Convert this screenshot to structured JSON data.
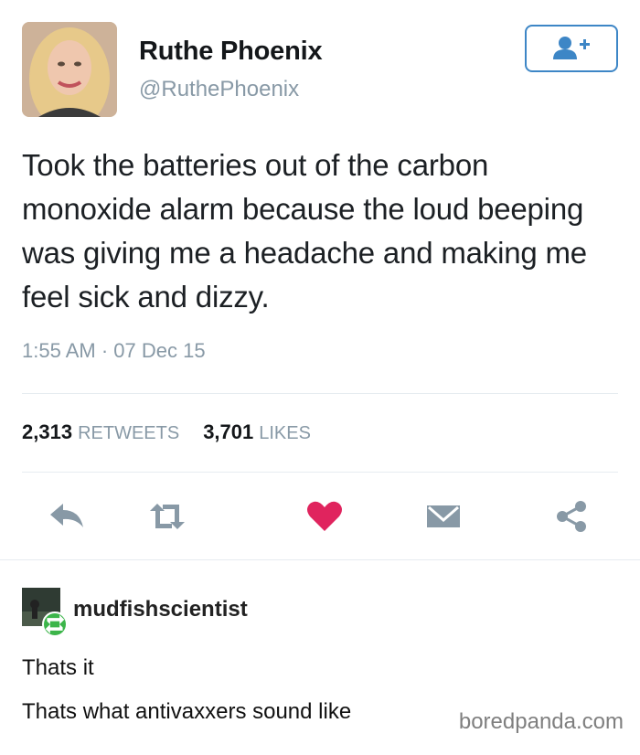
{
  "tweet": {
    "display_name": "Ruthe Phoenix",
    "handle": "@RuthePhoenix",
    "text": "Took the batteries out of the carbon monoxide alarm because the loud beeping was giving me a headache and making me feel sick and dizzy.",
    "timestamp": "1:55 AM · 07 Dec 15",
    "retweets_count": "2,313",
    "retweets_label": "RETWEETS",
    "likes_count": "3,701",
    "likes_label": "LIKES",
    "follow_icon": "add-user-icon",
    "colors": {
      "accent": "#3d86c6",
      "like": "#e0245e",
      "muted": "#8899a6"
    },
    "actions": [
      {
        "icon": "reply-icon"
      },
      {
        "icon": "retweet-icon"
      },
      {
        "icon": "heart-icon"
      },
      {
        "icon": "message-icon"
      },
      {
        "icon": "share-icon"
      }
    ]
  },
  "reblog": {
    "username": "mudfishscientist",
    "badge_icon": "reblog-icon",
    "lines": [
      "Thats it",
      "Thats what antivaxxers sound like"
    ]
  },
  "watermark": "boredpanda.com"
}
